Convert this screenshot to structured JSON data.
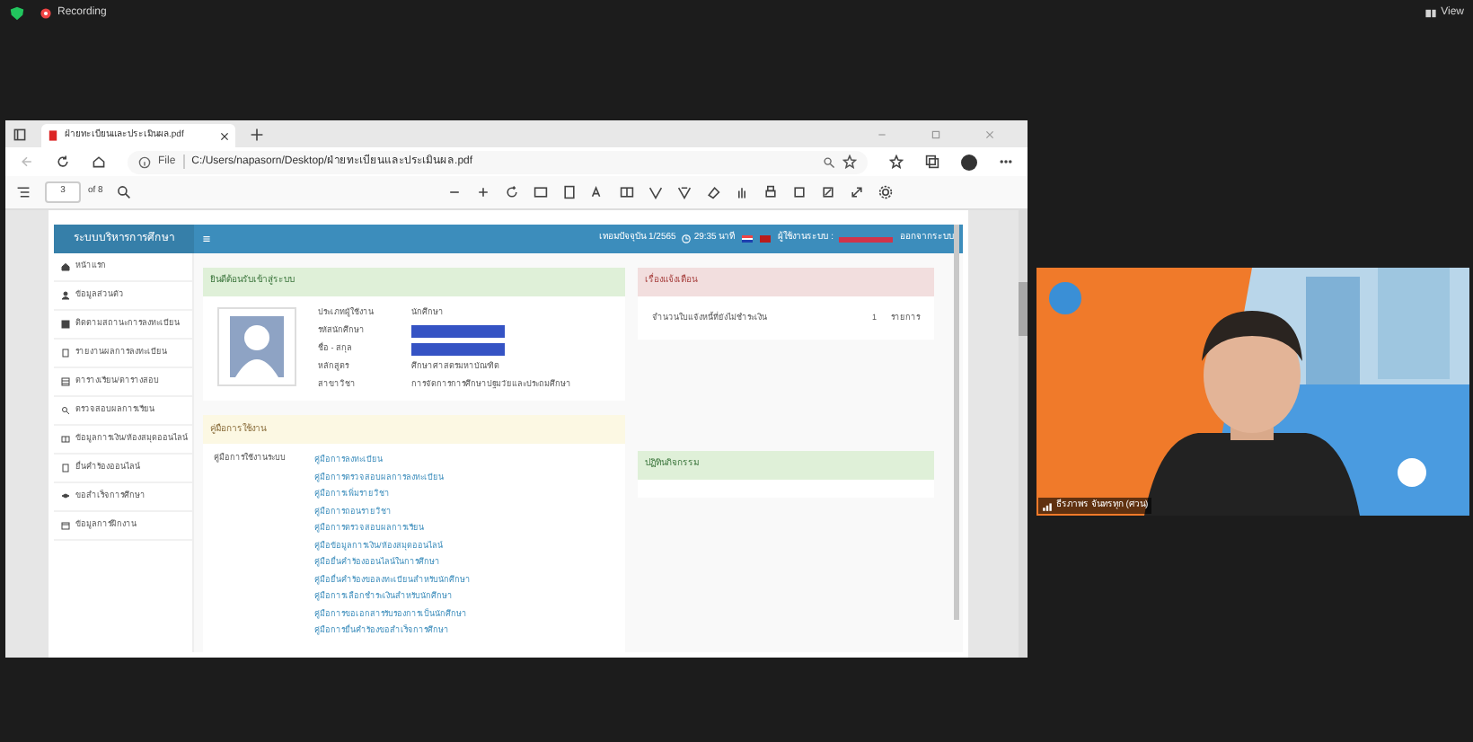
{
  "meeting": {
    "recording_label": "Recording",
    "view_label": "View"
  },
  "browser": {
    "tab_title": "ฝ่ายทะเบียนและประเมินผล.pdf",
    "url_scheme": "File",
    "url": "C:/Users/napasorn/Desktop/ฝ่ายทะเบียนและประเมินผล.pdf",
    "page_number": "3",
    "page_count": "of 8"
  },
  "portal": {
    "title": "ระบบบริหารการศึกษา",
    "term": "เทอมปัจจุบัน 1/2565",
    "time": "29:35 นาที",
    "user_label": "ผู้ใช้งานระบบ :",
    "logout": "ออกจากระบบ",
    "sidebar": [
      {
        "label": "หน้าแรก"
      },
      {
        "label": "ข้อมูลส่วนตัว"
      },
      {
        "label": "ติดตามสถานะการลงทะเบียน"
      },
      {
        "label": "รายงานผลการลงทะเบียน"
      },
      {
        "label": "ตารางเรียน/ตารางสอบ"
      },
      {
        "label": "ตรวจสอบผลการเรียน"
      },
      {
        "label": "ข้อมูลการเงิน/ห้องสมุดออนไลน์"
      },
      {
        "label": "ยื่นคำร้องออนไลน์"
      },
      {
        "label": "ขอสำเร็จการศึกษา"
      },
      {
        "label": "ข้อมูลการฝึกงาน"
      }
    ],
    "welcome": {
      "title": "ยินดีต้อนรับเข้าสู่ระบบ",
      "fields": [
        {
          "label": "ประเภทผู้ใช้งาน",
          "kind": "text",
          "value": "นักศึกษา"
        },
        {
          "label": "รหัสนักศึกษา",
          "kind": "redacted"
        },
        {
          "label": "ชื่อ - สกุล",
          "kind": "redacted"
        },
        {
          "label": "หลักสูตร",
          "kind": "text",
          "value": "ศึกษาศาสตรมหาบัณฑิต"
        },
        {
          "label": "สาขาวิชา",
          "kind": "text",
          "value": "การจัดการการศึกษาปฐมวัยและประถมศึกษา"
        }
      ]
    },
    "manual": {
      "title": "คู่มือการใช้งาน",
      "label": "คู่มือการใช้งานระบบ",
      "links": [
        "คู่มือการลงทะเบียน",
        "คู่มือการตรวจสอบผลการลงทะเบียน",
        "คู่มือการเพิ่มรายวิชา",
        "คู่มือการถอนรายวิชา",
        "คู่มือการตรวจสอบผลการเรียน",
        "คู่มือข้อมูลการเงิน/ห้องสมุดออนไลน์",
        "คู่มือยื่นคำร้องออนไลน์ในการศึกษา",
        "คู่มือยื่นคำร้องขอลงทะเบียนสำหรับนักศึกษา",
        "คู่มือการเลือกชำระเงินสำหรับนักศึกษา",
        "คู่มือการขอเอกสารรับรองการเป็นนักศึกษา",
        "คู่มือการยื่นคำร้องขอสำเร็จการศึกษา"
      ]
    },
    "alerts": {
      "title": "เรื่องแจ้งเตือน",
      "rows": [
        {
          "label": "จำนวนใบแจ้งหนี้ที่ยังไม่ชำระเงิน",
          "count": "1",
          "unit": "รายการ"
        }
      ]
    },
    "calendar": {
      "title": "ปฏิทินกิจกรรม"
    }
  },
  "video": {
    "kind": "picture",
    "name": "ธีรภาพร จันทรทุก (ศวน)"
  }
}
